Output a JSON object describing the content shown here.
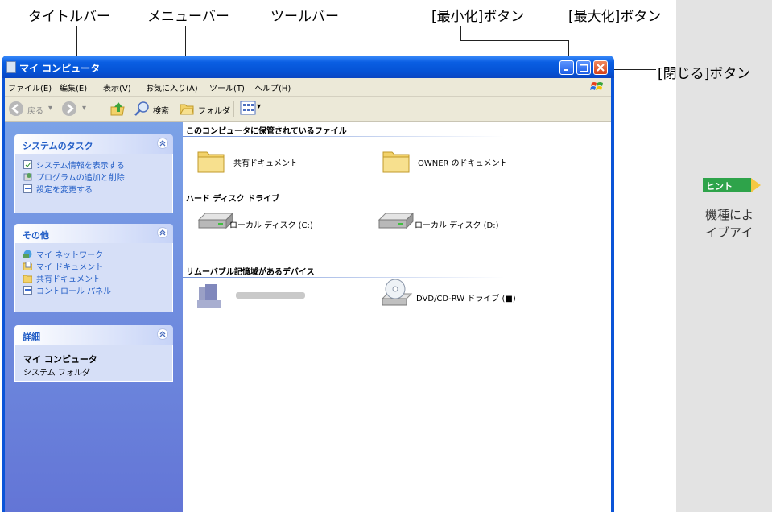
{
  "callouts": {
    "titlebar": "タイトルバー",
    "menubar": "メニューバー",
    "toolbar": "ツールバー",
    "minimize": "[最小化]ボタン",
    "maximize": "[最大化]ボタン",
    "close": "[閉じる]ボタン"
  },
  "window": {
    "title": "マイ コンピュータ"
  },
  "menu": [
    "ファイル(E)",
    "編集(E)",
    "表示(V)",
    "お気に入り(A)",
    "ツール(T)",
    "ヘルプ(H)"
  ],
  "toolbar": {
    "back": "戻る",
    "search": "検索",
    "folders": "フォルダ"
  },
  "tasks": {
    "system": {
      "title": "システムのタスク",
      "items": [
        "システム情報を表示する",
        "プログラムの追加と削除",
        "設定を変更する"
      ]
    },
    "other": {
      "title": "その他",
      "items": [
        "マイ ネットワーク",
        "マイ ドキュメント",
        "共有ドキュメント",
        "コントロール パネル"
      ]
    },
    "details": {
      "title": "詳細",
      "name": "マイ コンピュータ",
      "type": "システム フォルダ"
    }
  },
  "groups": {
    "files": {
      "title": "このコンピュータに保管されているファイル",
      "items": [
        "共有ドキュメント",
        "OWNER のドキュメント"
      ]
    },
    "drives": {
      "title": "ハード ディスク ドライブ",
      "items": [
        "ローカル ディスク (C:)",
        "ローカル ディスク (D:)"
      ]
    },
    "removable": {
      "title": "リムーバブル記憶域があるデバイス",
      "items": [
        "DVD/CD-RW ドライブ (■)"
      ]
    }
  },
  "hint": {
    "badge": "ヒント",
    "line1": "機種によ",
    "line2": "イブアイ"
  },
  "colors": {
    "xp_blue": "#0a54d8",
    "task_pane": "#6f8fe0",
    "link": "#215dc6",
    "hint_green": "#2ea34a"
  }
}
